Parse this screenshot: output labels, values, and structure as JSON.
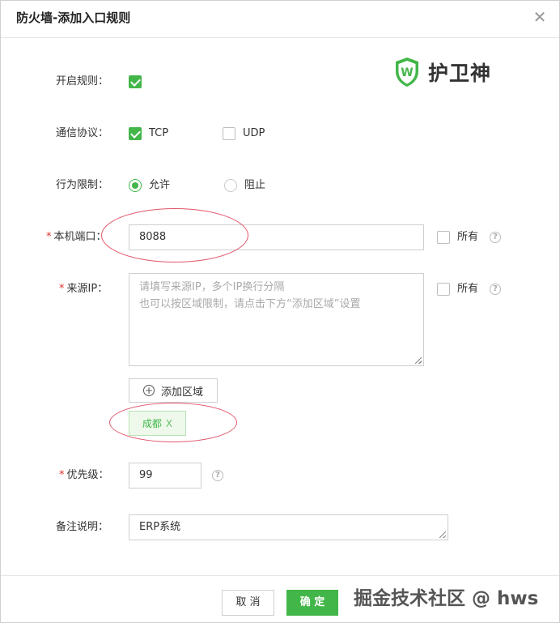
{
  "dialog": {
    "title": "防火墙-添加入口规则",
    "close_icon": "close-icon"
  },
  "logo": {
    "text": "护卫神",
    "letter": "W",
    "color": "#43b649"
  },
  "form": {
    "enable": {
      "label": "开启规则：",
      "checked": true
    },
    "protocol": {
      "label": "通信协议：",
      "tcp_label": "TCP",
      "tcp_checked": true,
      "udp_label": "UDP",
      "udp_checked": false
    },
    "action": {
      "label": "行为限制：",
      "allow_label": "允许",
      "allow_selected": true,
      "block_label": "阻止",
      "block_selected": false
    },
    "local_port": {
      "required_mark": "*",
      "label": "本机端口：",
      "value": "8088",
      "all_label": "所有",
      "help": "?"
    },
    "source_ip": {
      "required_mark": "*",
      "label": "来源IP：",
      "placeholder_line1": "请填写来源IP，多个IP换行分隔",
      "placeholder_line2": "也可以按区域限制，请点击下方“添加区域”设置",
      "all_label": "所有",
      "help": "?",
      "add_region_label": "添加区域",
      "tags": [
        {
          "label": "成都",
          "remove": "X"
        }
      ]
    },
    "priority": {
      "required_mark": "*",
      "label": "优先级：",
      "value": "99",
      "help": "?"
    },
    "remark": {
      "label": "备注说明：",
      "value": "ERP系统"
    }
  },
  "footer": {
    "cancel_label": "取 消",
    "ok_label": "确 定"
  },
  "watermark": "掘金技术社区 @ hws",
  "colors": {
    "accent": "#43b649",
    "annotation": "#e0566a",
    "required": "#e0302b"
  }
}
